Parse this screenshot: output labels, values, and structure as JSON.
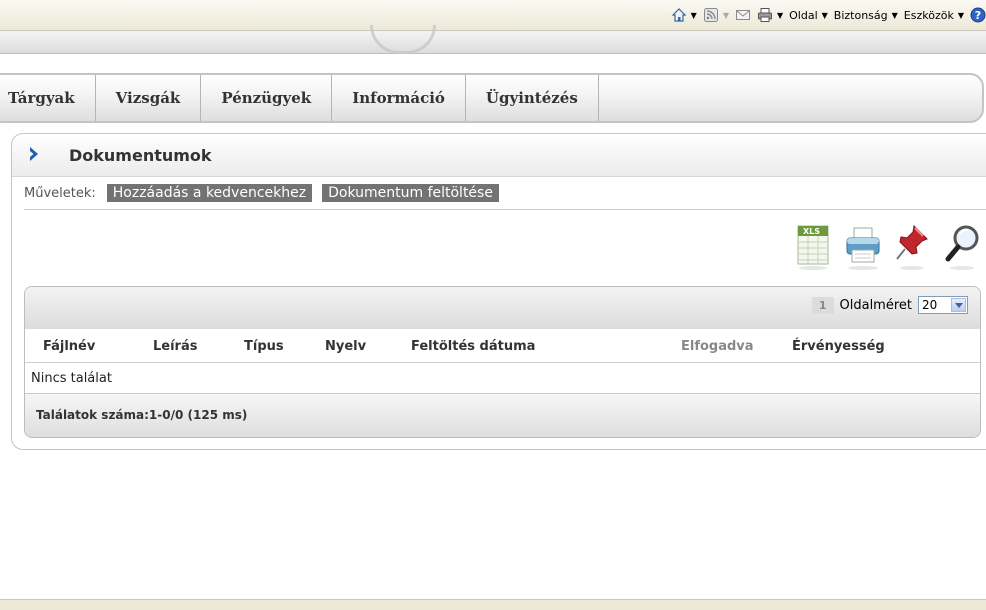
{
  "browser": {
    "home_label": "",
    "page_label": "Oldal",
    "security_label": "Biztonság",
    "tools_label": "Eszközök"
  },
  "nav": {
    "items": [
      {
        "label": "Tárgyak"
      },
      {
        "label": "Vizsgák"
      },
      {
        "label": "Pénzügyek"
      },
      {
        "label": "Információ"
      },
      {
        "label": "Ügyintézés"
      }
    ]
  },
  "panel": {
    "title": "Dokumentumok",
    "ops_label": "Műveletek:",
    "ops": [
      {
        "label": "Hozzáadás a kedvencekhez"
      },
      {
        "label": "Dokumentum feltöltése"
      }
    ],
    "tool_icons": [
      "xls-export-icon",
      "print-icon",
      "pin-icon",
      "search-icon"
    ]
  },
  "grid": {
    "page": "1",
    "page_size_label": "Oldalméret",
    "page_size": "20",
    "columns": [
      {
        "label": "Fájlnév"
      },
      {
        "label": "Leírás"
      },
      {
        "label": "Típus"
      },
      {
        "label": "Nyelv"
      },
      {
        "label": "Feltöltés dátuma"
      },
      {
        "label": "Elfogadva"
      },
      {
        "label": "Érvényesség"
      }
    ],
    "empty_text": "Nincs találat",
    "count_text": "Találatok száma:1-0/0 (125 ms)"
  },
  "colors": {
    "accent": "#1e5fb4",
    "button_bg": "#737373"
  }
}
